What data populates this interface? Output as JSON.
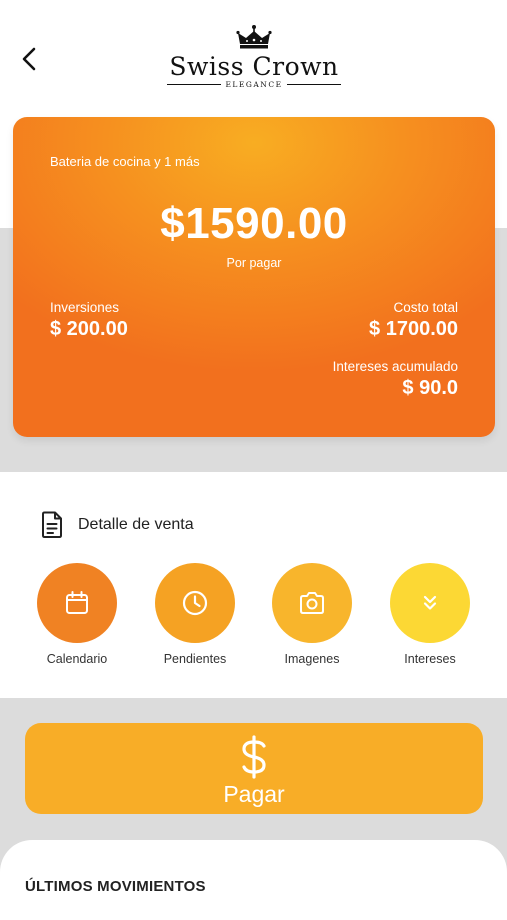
{
  "header": {
    "brand": "Swiss Crown",
    "brand_sub": "ELEGANCE",
    "back_icon": "chevron-left-icon"
  },
  "card": {
    "product": "Bateria de cocina y 1 más",
    "amount_due": "$1590.00",
    "amount_due_label": "Por pagar",
    "investments_label": "Inversiones",
    "investments_value": "$ 200.00",
    "total_cost_label": "Costo total",
    "total_cost_value": "$ 1700.00",
    "interest_label": "Intereses acumulado",
    "interest_value": "$ 90.0",
    "colors": {
      "start": "#f8ad22",
      "end": "#f2701e"
    }
  },
  "detail": {
    "label": "Detalle de venta",
    "icon": "document-icon"
  },
  "actions": [
    {
      "label": "Calendario",
      "icon": "calendar-icon",
      "color": "#f08223"
    },
    {
      "label": "Pendientes",
      "icon": "clock-icon",
      "color": "#f5a223"
    },
    {
      "label": "Imagenes",
      "icon": "camera-icon",
      "color": "#f8b52c"
    },
    {
      "label": "Intereses",
      "icon": "double-chevron-down-icon",
      "color": "#fcd834"
    }
  ],
  "pay_button": {
    "label": "Pagar",
    "icon": "dollar-icon",
    "color": "#f8ad27"
  },
  "movements": {
    "title": "ÚLTIMOS MOVIMIENTOS"
  }
}
